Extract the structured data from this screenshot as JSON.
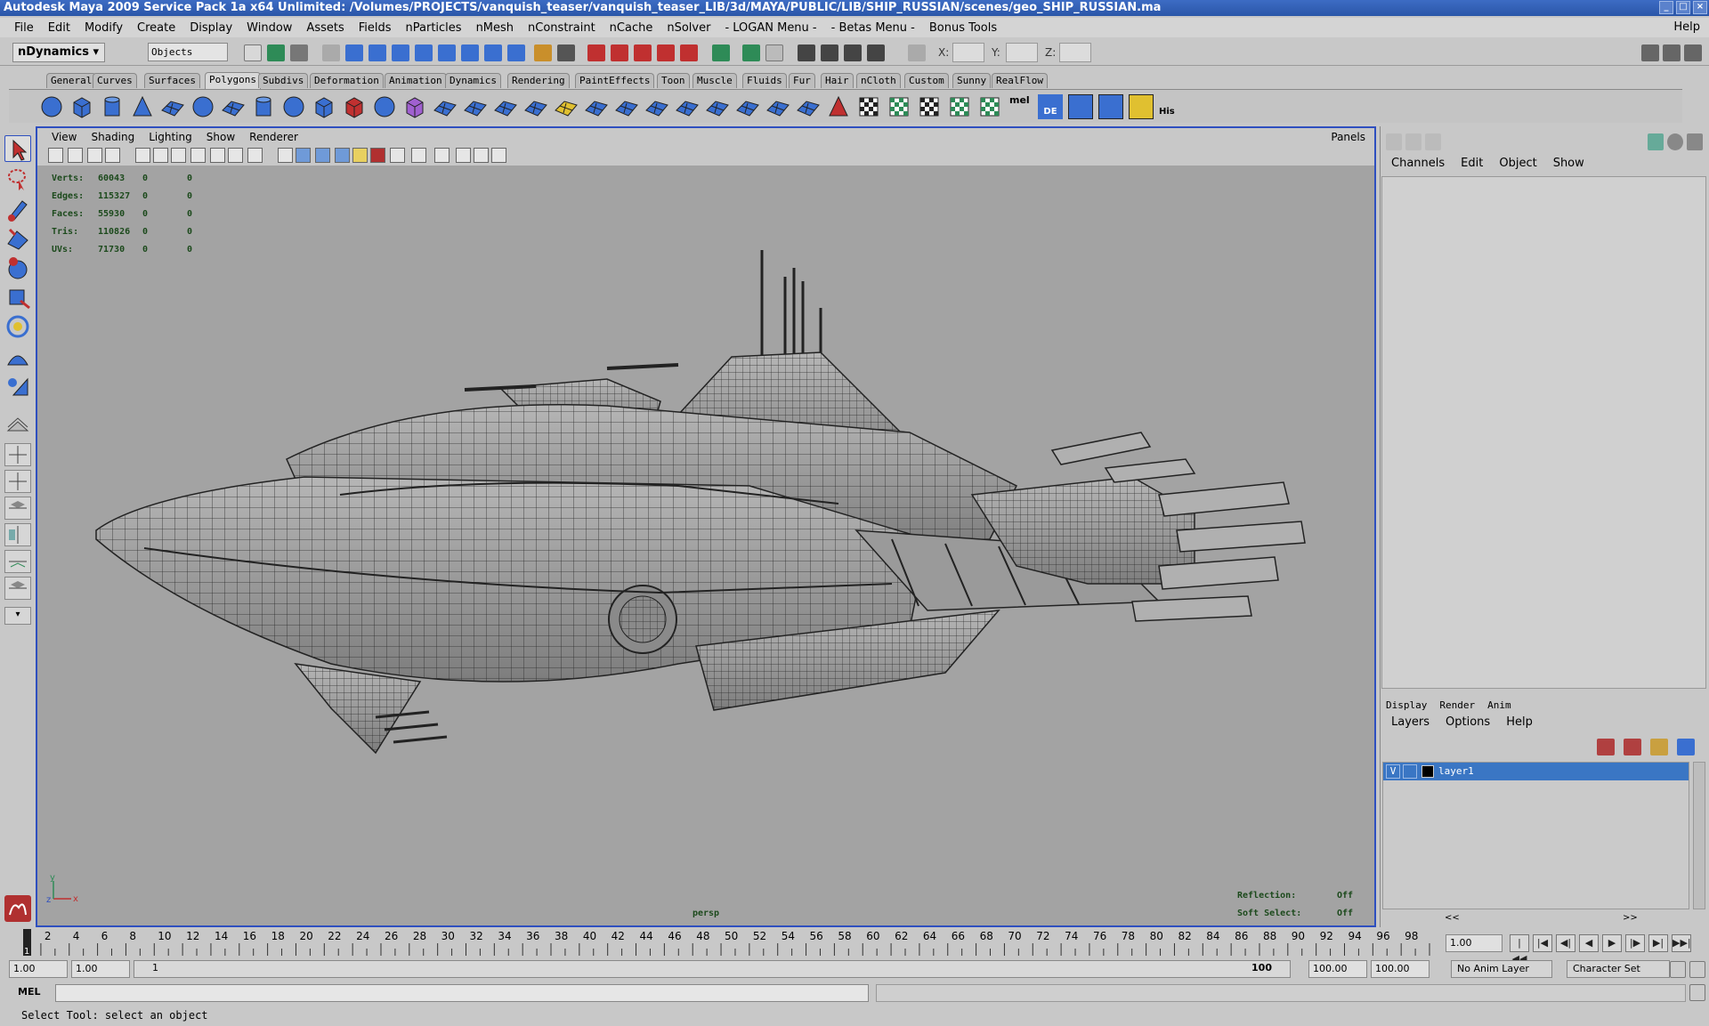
{
  "window": {
    "title": "Autodesk Maya 2009 Service Pack 1a x64 Unlimited: /Volumes/PROJECTS/vanquish_teaser/vanquish_teaser_LIB/3d/MAYA/PUBLIC/LIB/SHIP_RUSSIAN/scenes/geo_SHIP_RUSSIAN.ma"
  },
  "menubar": {
    "items": [
      "File",
      "Edit",
      "Modify",
      "Create",
      "Display",
      "Window",
      "Assets",
      "Fields",
      "nParticles",
      "nMesh",
      "nConstraint",
      "nCache",
      "nSolver",
      "- LOGAN Menu -",
      "- Betas Menu -",
      "Bonus Tools"
    ],
    "help": "Help"
  },
  "statusline": {
    "mode": "nDynamics",
    "selection_mask": "Objects",
    "x_label": "X:",
    "y_label": "Y:",
    "z_label": "Z:"
  },
  "shelf_tabs": [
    "General",
    "Curves",
    "Surfaces",
    "Polygons",
    "Subdivs",
    "Deformation",
    "Animation",
    "Dynamics",
    "Rendering",
    "PaintEffects",
    "Toon",
    "Muscle",
    "Fluids",
    "Fur",
    "Hair",
    "nCloth",
    "Custom",
    "Sunny",
    "RealFlow"
  ],
  "shelf_active_tab": "Polygons",
  "shelf_labels": {
    "mel": "mel",
    "de": "DE",
    "his": "His"
  },
  "viewport": {
    "menu": [
      "View",
      "Shading",
      "Lighting",
      "Show",
      "Renderer"
    ],
    "panels": "Panels",
    "hud": [
      {
        "label": "Verts:",
        "v1": "60043",
        "v2": "0",
        "v3": "0"
      },
      {
        "label": "Edges:",
        "v1": "115327",
        "v2": "0",
        "v3": "0"
      },
      {
        "label": "Faces:",
        "v1": "55930",
        "v2": "0",
        "v3": "0"
      },
      {
        "label": "Tris:",
        "v1": "110826",
        "v2": "0",
        "v3": "0"
      },
      {
        "label": "UVs:",
        "v1": "71730",
        "v2": "0",
        "v3": "0"
      }
    ],
    "camera": "persp",
    "reflection_label": "Reflection:",
    "reflection_value": "Off",
    "softselect_label": "Soft Select:",
    "softselect_value": "Off",
    "axis": {
      "x": "x",
      "y": "y",
      "z": "z"
    }
  },
  "channelbox": {
    "menu": [
      "Channels",
      "Edit",
      "Object",
      "Show"
    ]
  },
  "layereditor": {
    "tabs": [
      "Display",
      "Render",
      "Anim"
    ],
    "menu": [
      "Layers",
      "Options",
      "Help"
    ],
    "layers": [
      {
        "visible": "V",
        "name": "layer1"
      }
    ],
    "scroll_left": "<<",
    "scroll_right": ">>"
  },
  "timeslider": {
    "start": 1,
    "end": 100,
    "label_step": 2,
    "current_frame_marker": "1",
    "current_frame": "1.00"
  },
  "range": {
    "start": "1.00",
    "playback_start": "1.00",
    "range_left": "1",
    "range_right": "100",
    "playback_end": "100.00",
    "end": "100.00",
    "anim_layer": "No Anim Layer",
    "character_set": "Character Set"
  },
  "cmdline": {
    "label": "MEL"
  },
  "helpline": {
    "text": "Select Tool: select an object"
  },
  "colors": {
    "viewport_bg": "#a3a3a3",
    "active_panel_border": "#2e4fbf",
    "title_bar": "#2a56a8",
    "hud_text": "#1c4a1c",
    "layer_selected": "#3a76c4"
  }
}
